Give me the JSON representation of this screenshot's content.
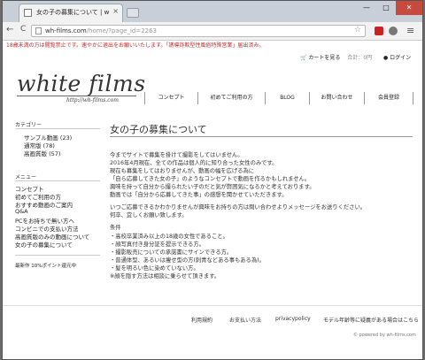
{
  "browser": {
    "tab_title": "女の子の募集について | wh-films.",
    "tab_close": "×",
    "url_host": "wh-films.com",
    "url_path": "/home/?page_id=2263",
    "back": "←",
    "forward": "→",
    "reload": "C",
    "star": "☆",
    "menu": "≡",
    "min": "—",
    "max": "□",
    "close": "✕"
  },
  "notice": "18歳未満の方は閲覧禁止です。速やかに退出をお願いいたします。「誘導詐欺型性風俗特殊営業」届出済み。",
  "header": {
    "cart_label": "カートを見る",
    "cart_sum": "合計：0円",
    "login_label": "ログイン",
    "logo_text": "white films",
    "logo_url": "http://wh-films.com"
  },
  "nav": [
    "コンセプト",
    "初めてご利用の方",
    "BLOG",
    "お問い合わせ",
    "会員登録"
  ],
  "sidebar": {
    "category_head": "カテゴリー",
    "categories": [
      "サンプル動画 (23)",
      "通常版 (78)",
      "高画質版 (57)"
    ],
    "menu_head": "メニュー",
    "menu": [
      "コンセプト",
      "初めてご利用の方",
      "おすすめ動画のご案内",
      "Q&A",
      "PCをお持ちで無い方へ",
      "コンビニでの支払い方法",
      "高画質版のみの動画について",
      "女の子の募集について"
    ],
    "promo": "最新作 10%ポイント還元中"
  },
  "main": {
    "title": "女の子の募集について",
    "paragraphs": [
      "今までサイトで募集を掛けて撮影をしてはいません。",
      "2016年4月現在、全ての作品は個人的に知り合った女性のみです。",
      "現在も募集をしてはおりませんが、動画の幅を広げる為に",
      "「自ら応募してきた女の子」のようなコンセプトで動画を作るかもしれません。",
      "興味を持って自分から撮られたい子のだと気が弊困気になるかと考えております。",
      "動画では「自分から応募してきた事」の感想を聞かせていただきます。",
      "いつご応募できるかわかりませんが興味をお持ちの方は問い合わせよりメッセージをお送りください。",
      "何卒、宜しくお願い致します。",
      "条件",
      "・高校卒業済み以上の18歳の女性であること。",
      "・顔写真付き身分証を提示できる方。",
      "・撮影販売についての承諾書にサインできる方。",
      "・普通体型、あるいは痩せ型の方(刺青などある事もある為)。",
      "・髪を明るい色に染めていない方。",
      "※顔を隠す方法は相談に乗らせて頂きます。"
    ]
  },
  "footer": {
    "links": [
      "利用規約",
      "お支払い方法",
      "privacypolicy",
      "モデル年齢等に疑義がある場合はこちら"
    ],
    "powered": "© powered by wh-films.com"
  }
}
